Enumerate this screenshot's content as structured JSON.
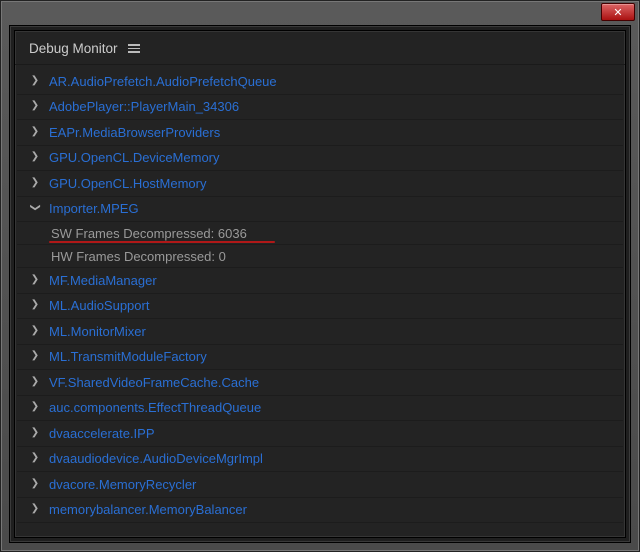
{
  "window": {
    "close_glyph": "✕"
  },
  "panel": {
    "title": "Debug Monitor"
  },
  "tree": {
    "items": [
      {
        "label": "AR.AudioPrefetch.AudioPrefetchQueue",
        "expanded": false
      },
      {
        "label": "AdobePlayer::PlayerMain_34306",
        "expanded": false
      },
      {
        "label": "EAPr.MediaBrowserProviders",
        "expanded": false
      },
      {
        "label": "GPU.OpenCL.DeviceMemory",
        "expanded": false
      },
      {
        "label": "GPU.OpenCL.HostMemory",
        "expanded": false
      },
      {
        "label": "Importer.MPEG",
        "expanded": true,
        "children": [
          {
            "text": "SW Frames Decompressed: 6036",
            "underline": true
          },
          {
            "text": "HW Frames Decompressed: 0",
            "underline": false
          }
        ]
      },
      {
        "label": "MF.MediaManager",
        "expanded": false
      },
      {
        "label": "ML.AudioSupport",
        "expanded": false
      },
      {
        "label": "ML.MonitorMixer",
        "expanded": false
      },
      {
        "label": "ML.TransmitModuleFactory",
        "expanded": false
      },
      {
        "label": "VF.SharedVideoFrameCache.Cache",
        "expanded": false
      },
      {
        "label": "auc.components.EffectThreadQueue",
        "expanded": false
      },
      {
        "label": "dvaaccelerate.IPP",
        "expanded": false
      },
      {
        "label": "dvaaudiodevice.AudioDeviceMgrImpl",
        "expanded": false
      },
      {
        "label": "dvacore.MemoryRecycler",
        "expanded": false
      },
      {
        "label": "memorybalancer.MemoryBalancer",
        "expanded": false
      }
    ]
  }
}
